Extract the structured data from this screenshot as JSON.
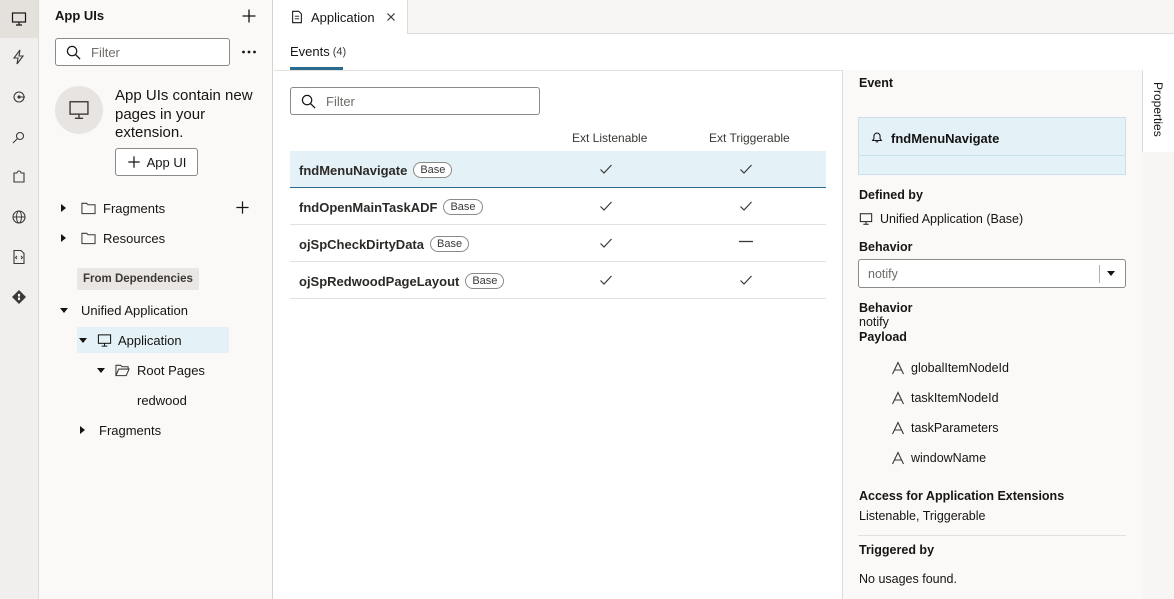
{
  "activity_bar": {
    "icons": [
      "app-uis-icon",
      "lightning-icon",
      "service-icon",
      "plug-icon",
      "puzzle-icon",
      "globe-icon",
      "source-icon",
      "git-icon"
    ]
  },
  "navigator": {
    "title": "App UIs",
    "filter_placeholder": "Filter",
    "empty_message": "App UIs contain new pages in your extension.",
    "add_app_ui_label": "App UI",
    "fragments_label": "Fragments",
    "resources_label": "Resources",
    "from_dependencies_label": "From Dependencies",
    "unified_application_label": "Unified Application",
    "application_label": "Application",
    "root_pages_label": "Root Pages",
    "redwood_label": "redwood",
    "fragments2_label": "Fragments"
  },
  "editor": {
    "tab_label": "Application",
    "subtab_label": "Events",
    "subtab_count": "(4)",
    "filter_placeholder": "Filter",
    "columns": {
      "listenable": "Ext Listenable",
      "triggerable": "Ext Triggerable"
    },
    "rows": [
      {
        "name": "fndMenuNavigate",
        "badge": "Base",
        "listenable": "check",
        "triggerable": "check"
      },
      {
        "name": "fndOpenMainTaskADF",
        "badge": "Base",
        "listenable": "check",
        "triggerable": "check"
      },
      {
        "name": "ojSpCheckDirtyData",
        "badge": "Base",
        "listenable": "check",
        "triggerable": "dash"
      },
      {
        "name": "ojSpRedwoodPageLayout",
        "badge": "Base",
        "listenable": "check",
        "triggerable": "check"
      }
    ]
  },
  "properties": {
    "tab_label": "Properties",
    "event_heading": "Event",
    "event_name": "fndMenuNavigate",
    "defined_by_label": "Defined by",
    "defined_by_value": "Unified Application (Base)",
    "behavior_label": "Behavior",
    "behavior_select_value": "notify",
    "behavior_label2": "Behavior",
    "behavior_value2": "notify",
    "payload_label": "Payload",
    "payload": [
      "globalItemNodeId",
      "taskItemNodeId",
      "taskParameters",
      "windowName"
    ],
    "access_label": "Access for Application Extensions",
    "access_value": "Listenable, Triggerable",
    "triggered_by_label": "Triggered by",
    "triggered_by_value": "No usages found."
  },
  "colors": {
    "accent": "#2b6a8f",
    "selected_row": "#e4f1f7",
    "panel_bg": "#fbf9f8"
  }
}
